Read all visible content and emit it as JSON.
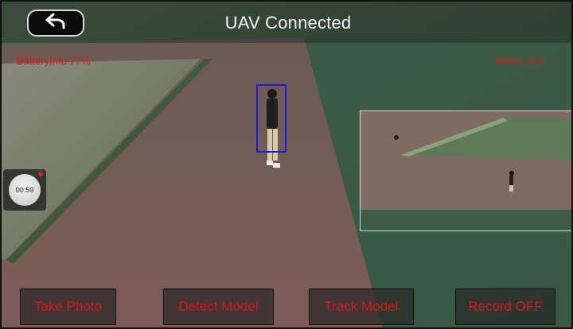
{
  "header": {
    "title": "UAV Connected",
    "back_icon": "back-arrow-icon"
  },
  "telemetry": {
    "battery": "BatteryInfo 77%",
    "status": "Status: Kcf"
  },
  "timer": {
    "value": "00:59"
  },
  "actions": [
    {
      "label": "Take Photo"
    },
    {
      "label": "Detect Model"
    },
    {
      "label": "Track Model"
    },
    {
      "label": "Record OFF"
    }
  ],
  "colors": {
    "overlay_text": "#e01818",
    "tracking_box": "#1a1ae0"
  }
}
